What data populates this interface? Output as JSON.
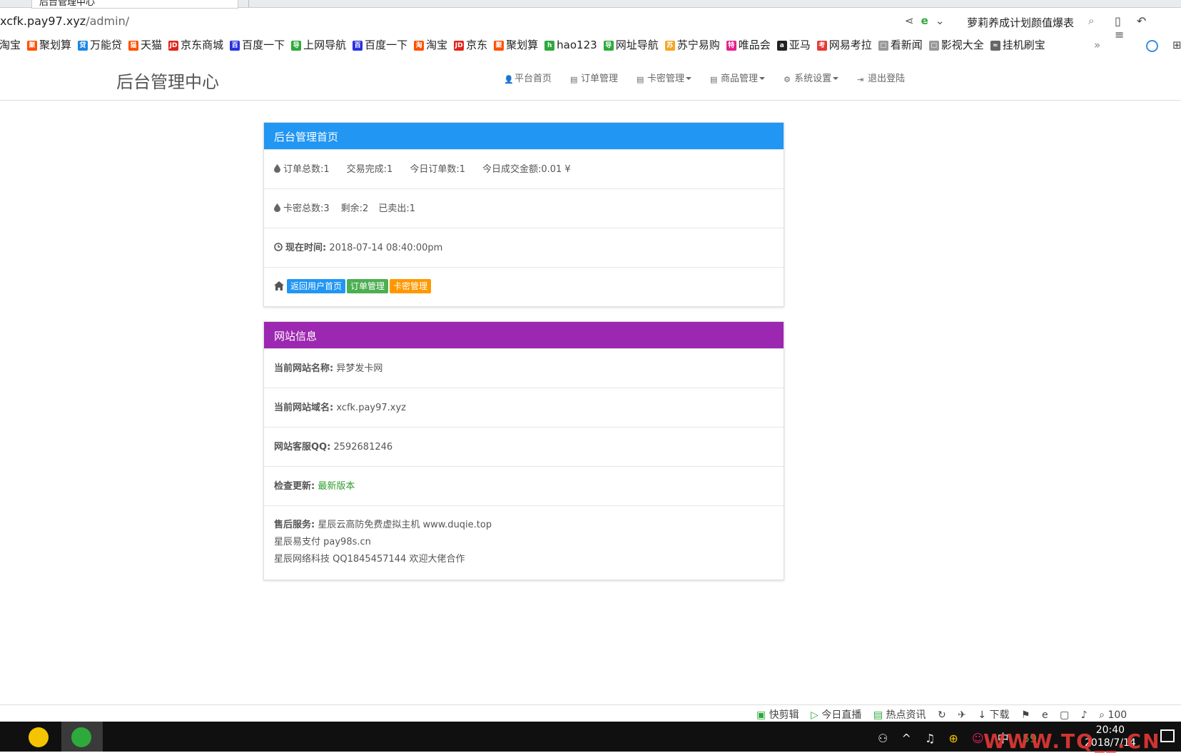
{
  "browser": {
    "tab_title": "后台管理中心",
    "url_host": "xcfk.pay97.xyz",
    "url_path": "/admin/",
    "hot_search": "萝莉养成计划颜值爆表",
    "bookmarks": [
      {
        "label": "淘宝",
        "icon": "taobao-icon",
        "color": "#ff5000",
        "glyph": "淘"
      },
      {
        "label": "聚划算",
        "icon": "juhuasuan-icon",
        "color": "#ff5000",
        "glyph": "聚"
      },
      {
        "label": "万能贷",
        "icon": "loan-icon",
        "color": "#1e88e5",
        "glyph": "贷"
      },
      {
        "label": "天猫",
        "icon": "tmall-icon",
        "color": "#ff5000",
        "glyph": "猫"
      },
      {
        "label": "京东商城",
        "icon": "jd-icon",
        "color": "#e1251b",
        "glyph": "JD"
      },
      {
        "label": "百度一下",
        "icon": "baidu-icon",
        "color": "#2932e1",
        "glyph": "百"
      },
      {
        "label": "上网导航",
        "icon": "nav-icon",
        "color": "#2eaa3c",
        "glyph": "导"
      },
      {
        "label": "百度一下",
        "icon": "baidu-icon",
        "color": "#2932e1",
        "glyph": "百"
      },
      {
        "label": "淘宝",
        "icon": "taobao-icon",
        "color": "#ff5000",
        "glyph": "淘"
      },
      {
        "label": "京东",
        "icon": "jd-icon",
        "color": "#e1251b",
        "glyph": "JD"
      },
      {
        "label": "聚划算",
        "icon": "juhuasuan-icon",
        "color": "#ff5000",
        "glyph": "聚"
      },
      {
        "label": "hao123",
        "icon": "hao123-icon",
        "color": "#2eaa3c",
        "glyph": "h"
      },
      {
        "label": "网址导航",
        "icon": "nav-icon",
        "color": "#2eaa3c",
        "glyph": "导"
      },
      {
        "label": "苏宁易购",
        "icon": "suning-icon",
        "color": "#f5a623",
        "glyph": "苏"
      },
      {
        "label": "唯品会",
        "icon": "vip-icon",
        "color": "#e91e8c",
        "glyph": "特"
      },
      {
        "label": "亚马",
        "icon": "amazon-icon",
        "color": "#222222",
        "glyph": "a"
      },
      {
        "label": "网易考拉",
        "icon": "kaola-icon",
        "color": "#e53935",
        "glyph": "考"
      },
      {
        "label": "看新闻",
        "icon": "page-icon",
        "color": "#999999",
        "glyph": "□"
      },
      {
        "label": "影视大全",
        "icon": "page-icon",
        "color": "#999999",
        "glyph": "□"
      },
      {
        "label": "挂机刷宝",
        "icon": "page-icon",
        "color": "#666666",
        "glyph": "≈"
      }
    ],
    "bookmarks_more": "»"
  },
  "site": {
    "brand": "后台管理中心",
    "menu": [
      {
        "label": "平台首页",
        "icon": "user-icon",
        "caret": false
      },
      {
        "label": "订单管理",
        "icon": "list-icon",
        "caret": false
      },
      {
        "label": "卡密管理",
        "icon": "list-icon",
        "caret": true
      },
      {
        "label": "商品管理",
        "icon": "list-icon",
        "caret": true
      },
      {
        "label": "系统设置",
        "icon": "gear-icon",
        "caret": true
      },
      {
        "label": "退出登陆",
        "icon": "logout-icon",
        "caret": false
      }
    ]
  },
  "panel_home": {
    "title": "后台管理首页",
    "header_color": "#2196f3",
    "stats_orders": [
      "订单总数:1",
      "交易完成:1",
      "今日订单数:1",
      "今日成交金额:0.01 ¥"
    ],
    "stats_cards": [
      "卡密总数:3",
      "剩余:2",
      "已卖出:1"
    ],
    "time_label": "现在时间:",
    "time_value": "2018-07-14 08:40:00pm",
    "buttons": [
      {
        "label": "返回用户首页",
        "color": "#2196f3"
      },
      {
        "label": "订单管理",
        "color": "#4caf50"
      },
      {
        "label": "卡密管理",
        "color": "#ff9800"
      }
    ]
  },
  "panel_site": {
    "title": "网站信息",
    "header_color": "#9c27b0",
    "name_label": "当前网站名称:",
    "name_value": "异梦发卡网",
    "domain_label": "当前网站域名:",
    "domain_value": "xcfk.pay97.xyz",
    "qq_label": "网站客服QQ:",
    "qq_value": "2592681246",
    "update_label": "检查更新:",
    "update_value": "最新版本",
    "service_label": "售后服务:",
    "service_lines": [
      "星辰云高防免费虚拟主机 www.duqie.top",
      "星辰易支付 pay98s.cn",
      "星辰网络科技 QQ1845457144 欢迎大佬合作"
    ]
  },
  "statusbar": {
    "items": [
      "快剪辑",
      "今日直播",
      "热点资讯",
      "下载",
      "100"
    ]
  },
  "taskbar": {
    "time": "20:40",
    "date": "2018/7/14",
    "ime": "中",
    "badge": "59"
  },
  "watermark": "WWW.TQ__.CN"
}
